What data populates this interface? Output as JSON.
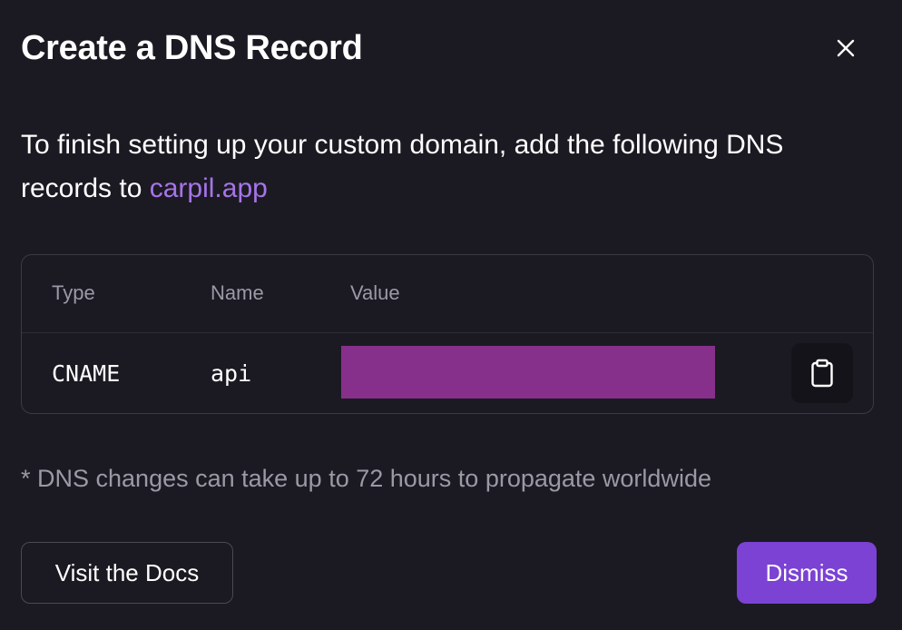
{
  "dialog": {
    "title": "Create a DNS Record",
    "close_icon": "close-icon"
  },
  "intro": {
    "text": "To finish setting up your custom domain, add the following DNS records to ",
    "domain": "carpil.app",
    "domain_color": "#a774e8"
  },
  "records": {
    "columns": [
      "Type",
      "Name",
      "Value"
    ],
    "rows": [
      {
        "type": "CNAME",
        "name": "api",
        "value_redacted_color": "#87308b",
        "copy_icon": "clipboard-icon"
      }
    ]
  },
  "footnote": "* DNS changes can take up to 72 hours to propagate worldwide",
  "actions": {
    "docs_label": "Visit the Docs",
    "dismiss_label": "Dismiss",
    "primary_color": "#7b42d4"
  }
}
